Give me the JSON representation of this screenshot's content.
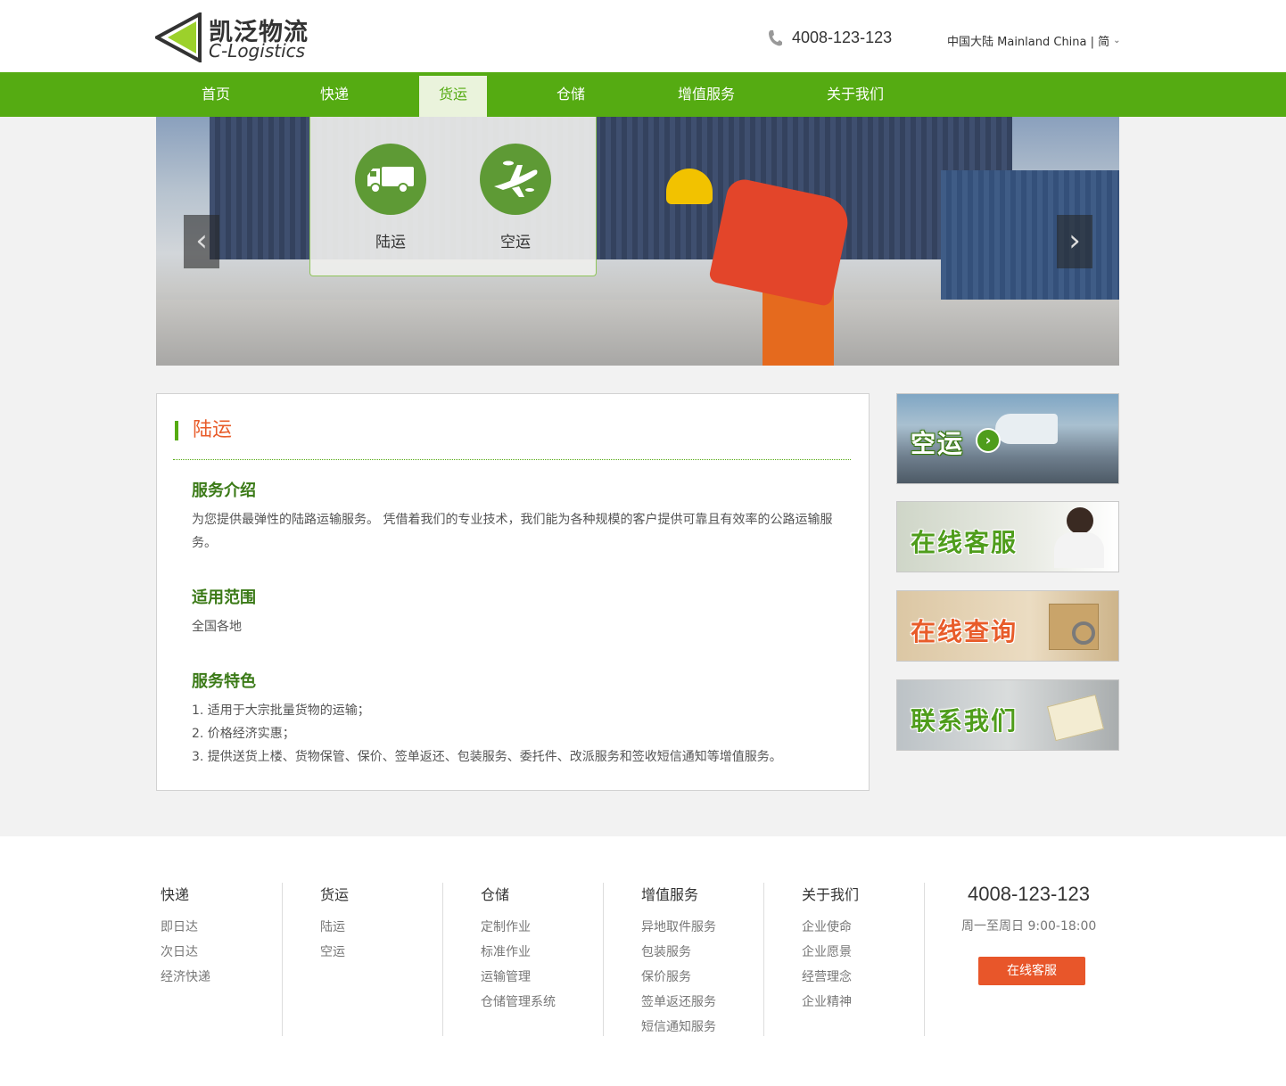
{
  "header": {
    "logo_cn": "凯泛物流",
    "logo_en": "C-Logistics",
    "phone": "4008-123-123",
    "region": "中国大陆 Mainland China | 简"
  },
  "nav": [
    {
      "label": "首页"
    },
    {
      "label": "快递"
    },
    {
      "label": "货运",
      "active": true
    },
    {
      "label": "仓储"
    },
    {
      "label": "增值服务"
    },
    {
      "label": "关于我们"
    }
  ],
  "dropdown": [
    {
      "label": "陆运",
      "icon": "truck-icon"
    },
    {
      "label": "空运",
      "icon": "airplane-icon"
    }
  ],
  "content": {
    "title": "陆运",
    "sections": [
      {
        "heading": "服务介绍",
        "body": [
          "为您提供最弹性的陆路运输服务。 凭借着我们的专业技术，我们能为各种规模的客户提供可靠且有效率的公路运输服务。"
        ]
      },
      {
        "heading": "适用范围",
        "body": [
          "全国各地"
        ]
      },
      {
        "heading": "服务特色",
        "body": [
          "1. 适用于大宗批量货物的运输；",
          "2. 价格经济实惠；",
          "3. 提供送货上楼、货物保管、保价、签单返还、包装服务、委托件、改派服务和签收短信通知等增值服务。"
        ]
      }
    ]
  },
  "side_banners": [
    {
      "label": "空运"
    },
    {
      "label": "在线客服"
    },
    {
      "label": "在线查询"
    },
    {
      "label": "联系我们"
    }
  ],
  "footer": {
    "columns": [
      {
        "title": "快递",
        "links": [
          "即日达",
          "次日达",
          "经济快递"
        ]
      },
      {
        "title": "货运",
        "links": [
          "陆运",
          "空运"
        ]
      },
      {
        "title": "仓储",
        "links": [
          "定制作业",
          "标准作业",
          "运输管理",
          "仓储管理系统"
        ]
      },
      {
        "title": "增值服务",
        "links": [
          "异地取件服务",
          "包装服务",
          "保价服务",
          "签单返还服务",
          "短信通知服务"
        ]
      },
      {
        "title": "关于我们",
        "links": [
          "企业使命",
          "企业愿景",
          "经营理念",
          "企业精神"
        ]
      }
    ],
    "phone": "4008-123-123",
    "hours": "周一至周日  9:00-18:00",
    "service_button": "在线客服"
  },
  "colors": {
    "brand_green": "#55ab12",
    "accent_orange": "#e85c2a",
    "dark_green": "#3b7a17"
  }
}
